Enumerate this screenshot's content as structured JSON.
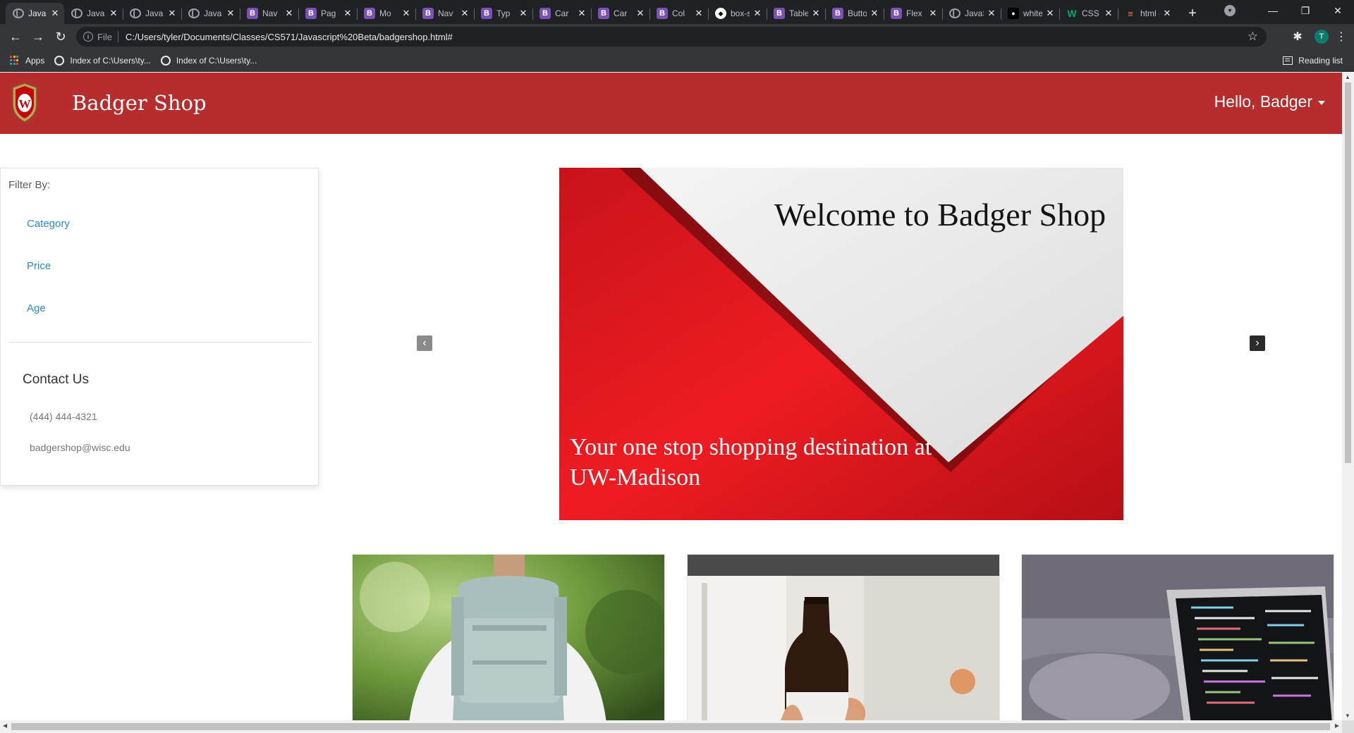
{
  "browser": {
    "tabs": [
      {
        "title": "Java",
        "icon": "globe-icon",
        "active": true
      },
      {
        "title": "Java",
        "icon": "globe-icon"
      },
      {
        "title": "Java",
        "icon": "globe-icon"
      },
      {
        "title": "Java",
        "icon": "globe-icon"
      },
      {
        "title": "Nav",
        "icon": "bootstrap-icon"
      },
      {
        "title": "Pag",
        "icon": "bootstrap-icon"
      },
      {
        "title": "Mo",
        "icon": "bootstrap-icon"
      },
      {
        "title": "Nav",
        "icon": "bootstrap-icon"
      },
      {
        "title": "Typ",
        "icon": "bootstrap-icon"
      },
      {
        "title": "Car",
        "icon": "bootstrap-icon"
      },
      {
        "title": "Car",
        "icon": "bootstrap-icon"
      },
      {
        "title": "Col",
        "icon": "bootstrap-icon"
      },
      {
        "title": "box-sha",
        "icon": "mdn-icon"
      },
      {
        "title": "Tables",
        "icon": "bootstrap-icon"
      },
      {
        "title": "Buttons",
        "icon": "bootstrap-icon"
      },
      {
        "title": "Flex · Bo",
        "icon": "bootstrap-icon"
      },
      {
        "title": "JavaScri",
        "icon": "globe-icon"
      },
      {
        "title": "white ar",
        "icon": "github-icon"
      },
      {
        "title": "CSS for",
        "icon": "w3schools-icon"
      },
      {
        "title": "html - H",
        "icon": "stackoverflow-icon"
      }
    ],
    "address": {
      "scheme": "File",
      "url": "C:/Users/tyler/Documents/Classes/CS571/Javascript%20Beta/badgershop.html#"
    },
    "profile_initial": "T",
    "bookmarks": [
      {
        "label": "Apps",
        "icon": "apps-icon"
      },
      {
        "label": "Index of C:\\Users\\ty...",
        "icon": "globe-icon"
      },
      {
        "label": "Index of C:\\Users\\ty...",
        "icon": "globe-icon"
      }
    ],
    "reading_list": "Reading list"
  },
  "site": {
    "brand": "Badger Shop",
    "user_menu": "Hello, Badger",
    "colors": {
      "nav": "#b72c2d",
      "link": "#2a8ad6"
    }
  },
  "sidebar": {
    "filter_title": "Filter By:",
    "filters": [
      "Category",
      "Price",
      "Age"
    ],
    "contact_title": "Contact Us",
    "phone": "(444) 444-4321",
    "email": "badgershop@wisc.edu"
  },
  "hero": {
    "heading": "Welcome to Badger Shop",
    "tagline": "Your one stop shopping destination at UW-Madison",
    "prev_icon": "chevron-left-icon",
    "next_icon": "chevron-right-icon"
  },
  "products": [
    {
      "image": "backpack"
    },
    {
      "image": "bottle"
    },
    {
      "image": "laptop"
    }
  ]
}
